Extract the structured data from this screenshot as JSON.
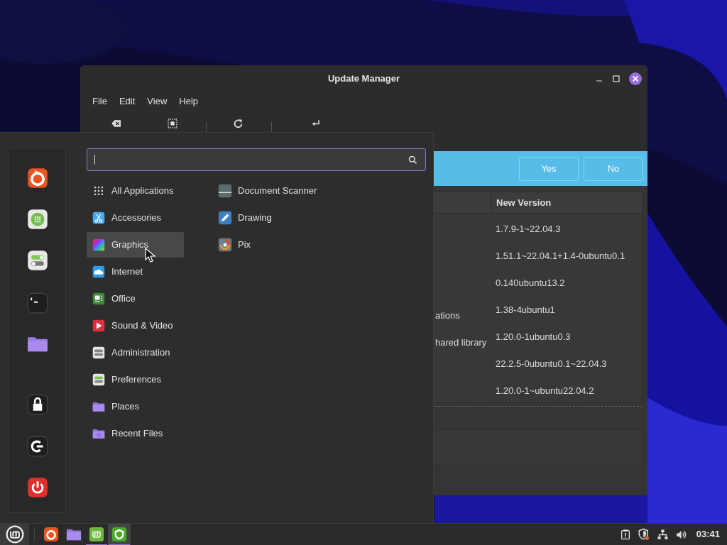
{
  "window": {
    "title": "Update Manager",
    "menu": [
      "File",
      "Edit",
      "View",
      "Help"
    ],
    "info_bar": {
      "buttons": [
        "Yes",
        "No"
      ]
    },
    "table": {
      "header": "New Version",
      "rows": [
        {
          "new_version": "1.7.9-1~22.04.3"
        },
        {
          "new_version": "1.51.1~22.04.1+1.4-0ubuntu0.1"
        },
        {
          "new_version": "0.140ubuntu13.2"
        },
        {
          "description": "ations",
          "new_version": "1.38-4ubuntu1"
        },
        {
          "description": "hared library",
          "new_version": "1.20.0-1ubuntu0.3"
        },
        {
          "new_version": "22.2.5-0ubuntu0.1~22.04.3"
        },
        {
          "new_version": "1.20.0-1~ubuntu22.04.2"
        }
      ]
    }
  },
  "app_menu": {
    "categories": [
      {
        "label": "All Applications",
        "selected": false
      },
      {
        "label": "Accessories",
        "selected": false
      },
      {
        "label": "Graphics",
        "selected": true
      },
      {
        "label": "Internet",
        "selected": false
      },
      {
        "label": "Office",
        "selected": false
      },
      {
        "label": "Sound & Video",
        "selected": false
      },
      {
        "label": "Administration",
        "selected": false
      },
      {
        "label": "Preferences",
        "selected": false
      },
      {
        "label": "Places",
        "selected": false
      },
      {
        "label": "Recent Files",
        "selected": false
      }
    ],
    "applications": [
      {
        "label": "Document Scanner"
      },
      {
        "label": "Drawing"
      },
      {
        "label": "Pix"
      }
    ]
  },
  "taskbar": {
    "launchers": [
      {
        "running": false,
        "active": false
      },
      {
        "running": false,
        "active": false
      },
      {
        "running": true,
        "active": false
      },
      {
        "running": true,
        "active": true
      }
    ],
    "clock": "03:41"
  }
}
